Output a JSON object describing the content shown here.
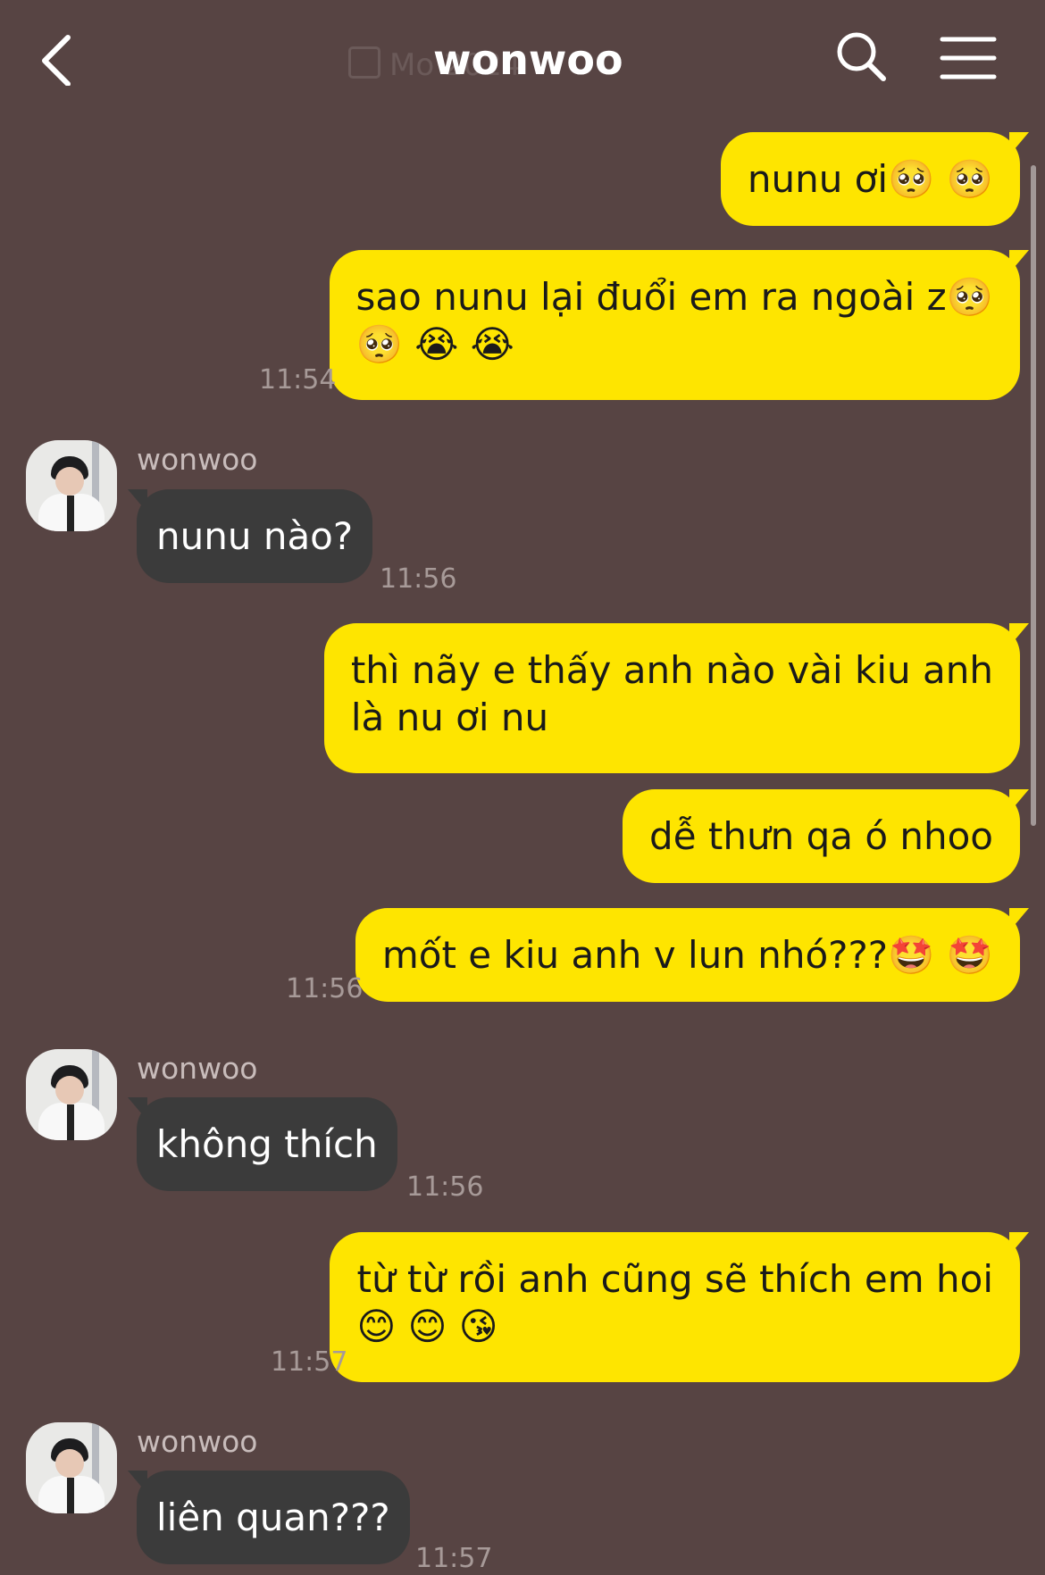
{
  "header": {
    "title": "wonwoo",
    "date_ghost": "Mo            2024"
  },
  "messages": [
    {
      "text": "nunu ơi🥺 🥺"
    },
    {
      "text": "sao nunu lại đuổi em ra ngoài z🥺\n🥺 😭 😭",
      "time": "11:54"
    },
    {
      "sender": "wonwoo",
      "text": "nunu nào?",
      "time": "11:56"
    },
    {
      "text": "thì nãy e thấy anh nào vài kiu anh\nlà nu ơi nu"
    },
    {
      "text": "dễ thưn qa ó nhoo"
    },
    {
      "text": "mốt e kiu anh v lun nhó???🤩 🤩",
      "time": "11:56"
    },
    {
      "sender": "wonwoo",
      "text": "không thích",
      "time": "11:56"
    },
    {
      "text": "từ từ rồi anh cũng sẽ thích em hoi\n😊 😊 😘",
      "time": "11:57"
    },
    {
      "sender": "wonwoo",
      "text": "liên quan???",
      "time": "11:57"
    }
  ]
}
